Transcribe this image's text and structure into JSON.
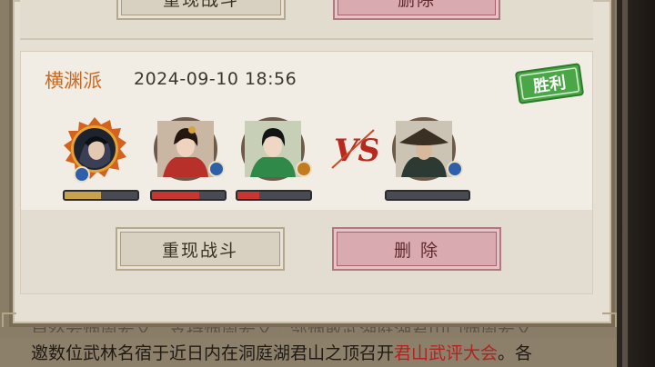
{
  "previous_record": {
    "replay_label": "重现战斗",
    "delete_label": "删除"
  },
  "record": {
    "sect_name": "横渊派",
    "datetime": "2024-09-10 18:56",
    "result_badge": "胜利",
    "vs_label": "VS",
    "allies": [
      {
        "name": "ally-hero-1",
        "hp": 0.5,
        "hp_color": "#c8a24a",
        "element": "water",
        "element_color": "#2f5fa8"
      },
      {
        "name": "ally-hero-2",
        "hp": 0.65,
        "hp_color": "#c9362f",
        "element": "water",
        "element_color": "#2f5fa8"
      },
      {
        "name": "ally-hero-3",
        "hp": 0.3,
        "hp_color": "#c9362f",
        "element": "fire",
        "element_color": "#c47a1e"
      }
    ],
    "enemies": [
      {
        "name": "enemy-hero-1",
        "hp": 0.0,
        "hp_color": "#c9362f",
        "element": "water",
        "element_color": "#2f5fa8"
      }
    ],
    "replay_label": "重现战斗",
    "delete_label": "删 除"
  },
  "background_text": {
    "before_highlight": "邀数位武林名宿于近日内在洞庭湖君山之顶召开",
    "highlight": "君山武评大会",
    "after_highlight": "。各"
  },
  "colors": {
    "sect_orange": "#c8691f",
    "win_green": "#3f9a3c",
    "delete_pink": "#d9aab0",
    "vs_red": "#b8281e"
  }
}
